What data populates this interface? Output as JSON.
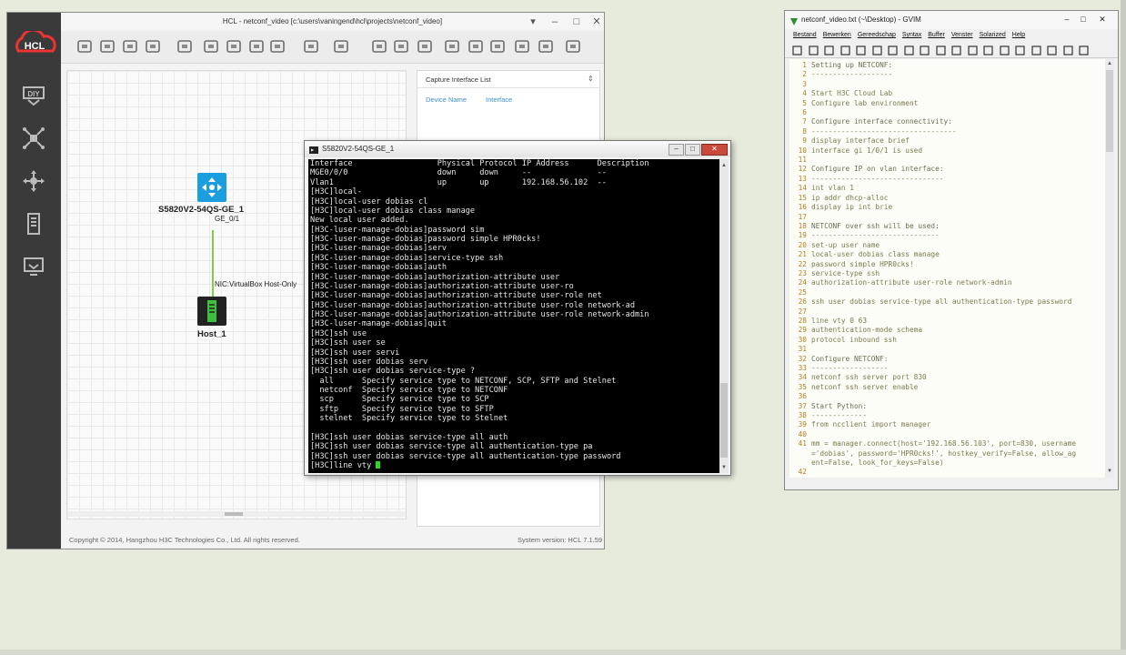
{
  "hcl": {
    "title": "HCL - netconf_video [c:\\users\\vaningend\\hcl\\projects\\netconf_video]",
    "logo": "HCL",
    "sidebar_icons": [
      "diy-icon",
      "topology-icon",
      "move-icon",
      "device-icon",
      "monitor-icon"
    ],
    "capture_panel": {
      "title": "Capture Interface List",
      "col_device": "Device Name",
      "col_interface": "Interface"
    },
    "switch_label": "S5820V2-54QS-GE_1",
    "switch_port": "GE_0/1",
    "link_label": "NIC:VirtualBox Host-Only",
    "host_label": "Host_1",
    "copyright": "Copyright © 2014, Hangzhou H3C Technologies Co., Ltd. All rights reserved.",
    "version": "System version: HCL 7.1.59",
    "toolbar_icons": [
      "new-icon",
      "open-icon",
      "save-icon",
      "export-icon",
      "screenshot-icon",
      "delete-icon",
      "grid-icon",
      "zoom-in-icon",
      "zoom-out-icon",
      "start-icon",
      "stop-icon",
      "list-icon",
      "add-text-icon",
      "add-shape-icon",
      "capture-icon",
      "settings-icon",
      "cmd-icon",
      "help-icon",
      "chat-icon",
      "user-icon"
    ]
  },
  "terminal": {
    "title": "S5820V2-54QS-GE_1",
    "lines": [
      "Interface                  Physical Protocol IP Address      Description",
      "MGE0/0/0                   down     down     --              --",
      "Vlan1                      up       up       192.168.56.102  --",
      "[H3C]local-",
      "[H3C]local-user dobias cl",
      "[H3C]local-user dobias class manage",
      "New local user added.",
      "[H3C-luser-manage-dobias]password sim",
      "[H3C-luser-manage-dobias]password simple HPR0cks!",
      "[H3C-luser-manage-dobias]serv",
      "[H3C-luser-manage-dobias]service-type ssh",
      "[H3C-luser-manage-dobias]auth",
      "[H3C-luser-manage-dobias]authorization-attribute user",
      "[H3C-luser-manage-dobias]authorization-attribute user-ro",
      "[H3C-luser-manage-dobias]authorization-attribute user-role net",
      "[H3C-luser-manage-dobias]authorization-attribute user-role network-ad",
      "[H3C-luser-manage-dobias]authorization-attribute user-role network-admin",
      "[H3C-luser-manage-dobias]quit",
      "[H3C]ssh use",
      "[H3C]ssh user se",
      "[H3C]ssh user servi",
      "[H3C]ssh user dobias serv",
      "[H3C]ssh user dobias service-type ?",
      "  all      Specify service type to NETCONF, SCP, SFTP and Stelnet",
      "  netconf  Specify service type to NETCONF",
      "  scp      Specify service type to SCP",
      "  sftp     Specify service type to SFTP",
      "  stelnet  Specify service type to Stelnet",
      "",
      "[H3C]ssh user dobias service-type all auth",
      "[H3C]ssh user dobias service-type all authentication-type pa",
      "[H3C]ssh user dobias service-type all authentication-type password"
    ],
    "prompt": "[H3C]line vty "
  },
  "gvim": {
    "title": "netconf_video.txt (~\\Desktop) - GVIM",
    "menu": [
      "Bestand",
      "Bewerken",
      "Gereedschap",
      "Syntax",
      "Buffer",
      "Venster",
      "Solarized",
      "Help"
    ],
    "lines": [
      {
        "n": "1",
        "t": "Setting up NETCONF:",
        "h": true
      },
      {
        "n": "2",
        "t": "-------------------"
      },
      {
        "n": "3",
        "t": ""
      },
      {
        "n": "4",
        "t": "Start H3C Cloud Lab"
      },
      {
        "n": "5",
        "t": "Configure lab environment"
      },
      {
        "n": "6",
        "t": ""
      },
      {
        "n": "7",
        "t": "Configure interface connectivity:",
        "h": true
      },
      {
        "n": "8",
        "t": "----------------------------------"
      },
      {
        "n": "9",
        "t": "display interface brief"
      },
      {
        "n": "10",
        "t": "interface gi 1/0/1 is used"
      },
      {
        "n": "11",
        "t": ""
      },
      {
        "n": "12",
        "t": "Configure IP on vlan interface:",
        "h": true
      },
      {
        "n": "13",
        "t": "-------------------------------"
      },
      {
        "n": "14",
        "t": "int vlan 1"
      },
      {
        "n": "15",
        "t": "ip addr dhcp-alloc"
      },
      {
        "n": "16",
        "t": "display ip int brie"
      },
      {
        "n": "17",
        "t": ""
      },
      {
        "n": "18",
        "t": "NETCONF over ssh will be used:",
        "h": true
      },
      {
        "n": "19",
        "t": "------------------------------"
      },
      {
        "n": "20",
        "t": "set-up user name"
      },
      {
        "n": "21",
        "t": "local-user dobias class manage"
      },
      {
        "n": "22",
        "t": "password simple HPR0cks!"
      },
      {
        "n": "23",
        "t": "service-type ssh"
      },
      {
        "n": "24",
        "t": "authorization-attribute user-role network-admin"
      },
      {
        "n": "25",
        "t": ""
      },
      {
        "n": "26",
        "t": "ssh user dobias service-type all authentication-type password"
      },
      {
        "n": "27",
        "t": ""
      },
      {
        "n": "28",
        "t": "line vty 0 63"
      },
      {
        "n": "29",
        "t": "authentication-mode schema"
      },
      {
        "n": "30",
        "t": "protocol inbound ssh"
      },
      {
        "n": "31",
        "t": ""
      },
      {
        "n": "32",
        "t": "Configure NETCONF:",
        "h": true
      },
      {
        "n": "33",
        "t": "------------------"
      },
      {
        "n": "34",
        "t": "netconf ssh server port 830"
      },
      {
        "n": "35",
        "t": "netconf ssh server enable"
      },
      {
        "n": "36",
        "t": ""
      },
      {
        "n": "37",
        "t": "Start Python:",
        "h": true
      },
      {
        "n": "38",
        "t": "-------------"
      },
      {
        "n": "39",
        "t": "from ncclient import manager"
      },
      {
        "n": "40",
        "t": ""
      },
      {
        "n": "41",
        "t": "mm = manager.connect(host='192.168.56.103', port=830, username"
      },
      {
        "n": "",
        "t": "='dobias', password='HPR0cks!', hostkey_verify=False, allow_ag"
      },
      {
        "n": "",
        "t": "ent=False, look_for_keys=False)"
      },
      {
        "n": "42",
        "t": ""
      }
    ]
  }
}
